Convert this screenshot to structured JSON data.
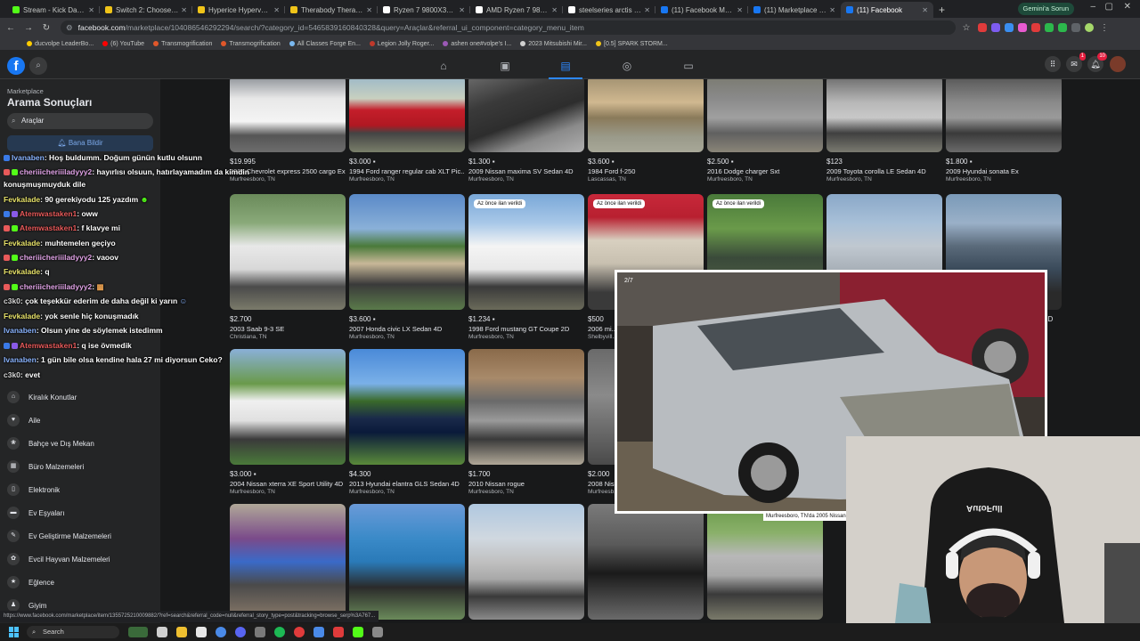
{
  "browser": {
    "tabs": [
      {
        "title": "Stream - Kick Dashboard",
        "color": "#53fc18"
      },
      {
        "title": "Switch 2: Choose Your Game",
        "color": "#f0c419"
      },
      {
        "title": "Hyperice Hypervolt Go 3 Fo",
        "color": "#f0c419"
      },
      {
        "title": "Therabody Theragun Relief",
        "color": "#f0c419"
      },
      {
        "title": "Ryzen 7 9800X3D - Google",
        "color": "#ffffff"
      },
      {
        "title": "AMD Ryzen 7 9800X3D Gam",
        "color": "#ffffff"
      },
      {
        "title": "steelseries arctis nova pro",
        "color": "#ffffff"
      },
      {
        "title": "(11) Facebook Marketplace",
        "color": "#1877f2"
      },
      {
        "title": "(11) Marketplace - 2005 Ta",
        "color": "#1877f2"
      },
      {
        "title": "(11) Facebook",
        "color": "#1877f2"
      }
    ],
    "new_tab": "+",
    "gemini_label": "Gemini'a Sorun",
    "url_domain": "facebook.com",
    "url_path": "/marketplace/104086546292294/search/?category_id=5465839160840328&query=Araçlar&referral_ui_component=category_menu_item",
    "bookmarks": [
      "ducvolpe LeaderBo...",
      "(6) YouTube",
      "Transmogrification",
      "Transmogrification",
      "All Classes Forge En...",
      "Legion Jolly Roger...",
      "ashen one#volpe's I...",
      "2023 Mitsubishi Mir...",
      "[0.5] SPARK STORM..."
    ],
    "status_url": "https://www.facebook.com/marketplace/item/1355725210009882/?ref=search&referral_code=null&referral_story_type=post&tracking=browse_serp%3A767..."
  },
  "header": {
    "logo": "f",
    "notif_count": "10",
    "msg_count": "1"
  },
  "sidebar": {
    "marketplace": "Marketplace",
    "title": "Arama Sonuçları",
    "search_value": "Araçlar",
    "notify_label": "Bana Bildir",
    "categories": [
      "Kiralık Konutlar",
      "Aile",
      "Bahçe ve Dış Mekan",
      "Büro Malzemeleri",
      "Elektronik",
      "Ev Eşyaları",
      "Ev Geliştirme Malzemeleri",
      "Evcil Hayvan Malzemeleri",
      "Eğlence",
      "Giyim"
    ]
  },
  "listings_row1": [
    {
      "price": "$19.995",
      "title": "2004 Chevrolet express 2500 cargo Ex...",
      "loc": "Murfreesboro, TN"
    },
    {
      "price": "$3.000",
      "title": "1994 Ford ranger regular cab XLT Pic...",
      "loc": "Murfreesboro, TN"
    },
    {
      "price": "$1.300",
      "title": "2009 Nissan maxima SV Sedan 4D",
      "loc": "Murfreesboro, TN"
    },
    {
      "price": "$3.600",
      "title": "1984 Ford f-250",
      "loc": "Lascassas, TN"
    },
    {
      "price": "$2.500",
      "title": "2016 Dodge charger Sxt",
      "loc": "Murfreesboro, TN"
    },
    {
      "price": "$123",
      "title": "2009 Toyota corolla LE Sedan 4D",
      "loc": "Murfreesboro, TN"
    },
    {
      "price": "$1.800",
      "title": "2009 Hyundai sonata Ex",
      "loc": "Murfreesboro, TN"
    }
  ],
  "listings_row2": [
    {
      "price": "$2.700",
      "title": "2003 Saab 9-3 SE",
      "loc": "Christiana, TN",
      "tag": ""
    },
    {
      "price": "$3.600",
      "title": "2007 Honda civic LX Sedan 4D",
      "loc": "Murfreesboro, TN",
      "tag": ""
    },
    {
      "price": "$1.234",
      "title": "1998 Ford mustang GT Coupe 2D",
      "loc": "Murfreesboro, TN",
      "tag": "Az önce ilan verildi"
    },
    {
      "price": "$500",
      "title": "2006 mi...",
      "loc": "Shelbyvill...",
      "tag": "Az önce ilan verildi"
    },
    {
      "price": "",
      "title": "",
      "loc": "",
      "tag": "Az önce ilan verildi"
    },
    {
      "price": "",
      "title": "",
      "loc": "",
      "tag": ""
    },
    {
      "price": "",
      "title": "2D",
      "loc": "",
      "tag": ""
    }
  ],
  "listings_row3": [
    {
      "price": "$3.000",
      "title": "2004 Nissan xterra XE Sport Utility 4D",
      "loc": "Murfreesboro, TN"
    },
    {
      "price": "$4.300",
      "title": "2013 Hyundai elantra GLS Sedan 4D",
      "loc": "Murfreesboro, TN"
    },
    {
      "price": "$1.700",
      "title": "2010 Nissan rogue",
      "loc": "Murfreesboro, TN"
    },
    {
      "price": "$2.000",
      "title": "2008 Nis...",
      "loc": "Murfreesb..."
    }
  ],
  "popup": {
    "counter": "2/7",
    "caption": "Murfreesboro, TN'da 2005 Nissan s"
  },
  "chat": [
    {
      "user": "Ivanaben",
      "ucolor": "nm-b",
      "msg": ": Hoş buldumm. Doğum günün kutlu olsunn"
    },
    {
      "user": "cheriiicheriiiladyyy2",
      "ucolor": "nm-p",
      "msg": ": hayırlısı olsuun, hatırlayamadım da kimdin"
    },
    {
      "user": "",
      "ucolor": "nm-c",
      "msg": "konuşmuşmuyduk dile"
    },
    {
      "user": "Fevkalade",
      "ucolor": "nm-y",
      "msg": ": 90 gerekiyodu 125 yazdım"
    },
    {
      "user": "Atemwastaken1",
      "ucolor": "nm-r",
      "msg": ": oww"
    },
    {
      "user": "Atemwastaken1",
      "ucolor": "nm-r",
      "msg": ": f klavye mi"
    },
    {
      "user": "Fevkalade",
      "ucolor": "nm-y",
      "msg": ": muhtemelen geçiyo"
    },
    {
      "user": "cheriiicheriiiladyyy2",
      "ucolor": "nm-p",
      "msg": ": vaoov"
    },
    {
      "user": "Fevkalade",
      "ucolor": "nm-y",
      "msg": ": q"
    },
    {
      "user": "cheriiicheriiiladyyy2",
      "ucolor": "nm-p",
      "msg": ":"
    },
    {
      "user": "c3k0",
      "ucolor": "nm-c",
      "msg": ": çok teşekkür ederim de daha değil ki yarın"
    },
    {
      "user": "Fevkalade",
      "ucolor": "nm-y",
      "msg": ": yok senle hiç konuşmadık"
    },
    {
      "user": "Ivanaben",
      "ucolor": "nm-b",
      "msg": ": Olsun yine de söylemek istedimm"
    },
    {
      "user": "Atemwastaken1",
      "ucolor": "nm-r",
      "msg": ": q ise övmedik"
    },
    {
      "user": "Ivanaben",
      "ucolor": "nm-b",
      "msg": ": 1 gün bile olsa kendine hala 27 mi diyorsun Ceko?"
    },
    {
      "user": "c3k0",
      "ucolor": "nm-c",
      "msg": ": evet"
    }
  ],
  "taskbar": {
    "search_label": "Search"
  },
  "webcam": {
    "chair_brand": "AutoFull"
  }
}
